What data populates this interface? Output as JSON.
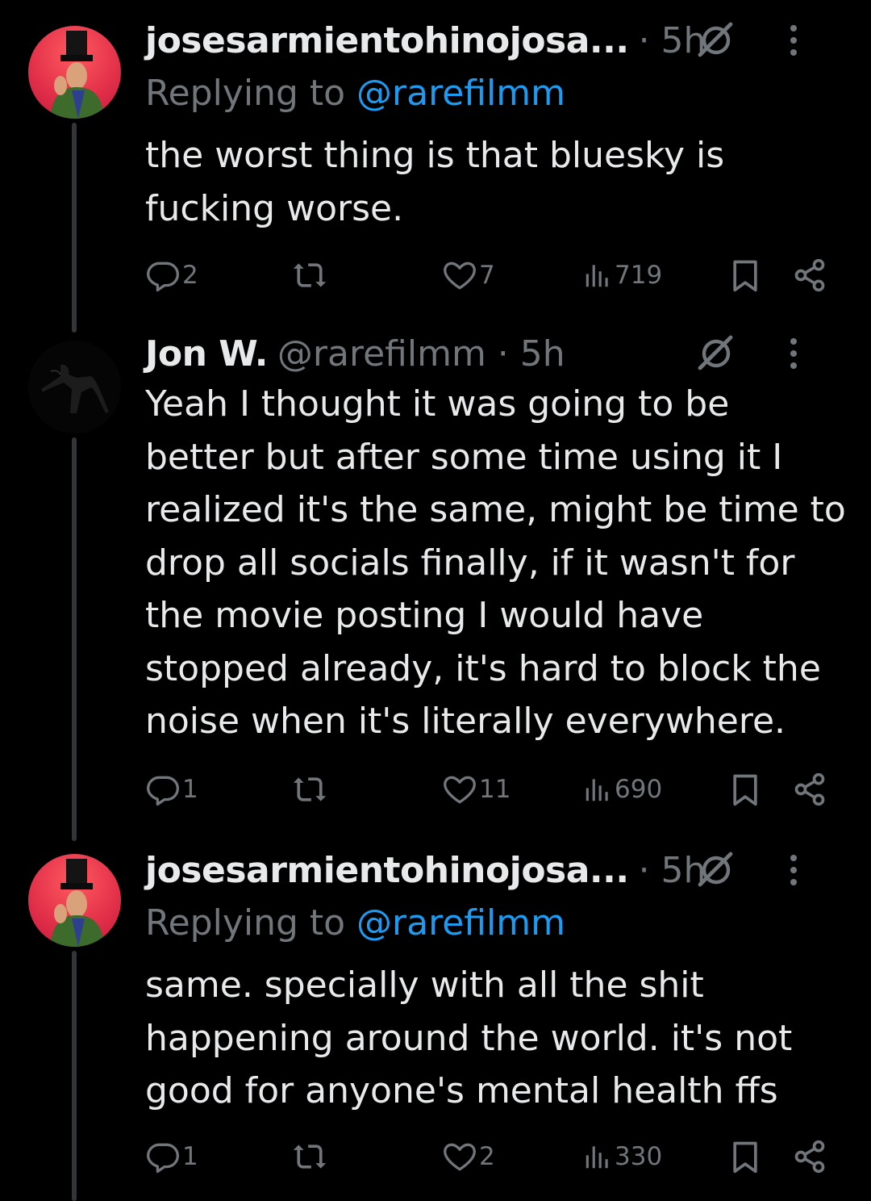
{
  "tweets": [
    {
      "name": "josesarmientohinojosa...",
      "meta": "· 5h",
      "replying_prefix": "Replying to ",
      "replying_handle": "@rarefilmm",
      "text": "the worst thing is that bluesky is\nfucking worse.",
      "replies": "2",
      "retweets": "",
      "likes": "7",
      "views": "719"
    },
    {
      "name": "Jon W.",
      "meta": "@rarefilmm · 5h",
      "text": "Yeah I thought it was going to be\nbetter but after some time using it I\nrealized it's the same, might be time to\ndrop all socials finally, if it wasn't for\nthe movie posting I would have\nstopped already, it's hard to block the\nnoise when it's literally everywhere.",
      "replies": "1",
      "retweets": "",
      "likes": "11",
      "views": "690"
    },
    {
      "name": "josesarmientohinojosa...",
      "meta": "· 5h",
      "replying_prefix": "Replying to ",
      "replying_handle": "@rarefilmm",
      "text": "same. specially with all the shit\nhappening around the world. it's not\ngood for anyone's mental health ffs",
      "replies": "1",
      "retweets": "",
      "likes": "2",
      "views": "330"
    }
  ],
  "colors": {
    "background": "#000000",
    "text": "#e7e9ea",
    "muted": "#71767b",
    "link": "#1d9bf0",
    "thread_line": "#333639"
  },
  "icons": {
    "reply": "reply-icon",
    "retweet": "retweet-icon",
    "like": "heart-icon",
    "views": "views-icon",
    "bookmark": "bookmark-icon",
    "share": "share-icon",
    "grok": "grok-icon",
    "more": "more-icon"
  }
}
